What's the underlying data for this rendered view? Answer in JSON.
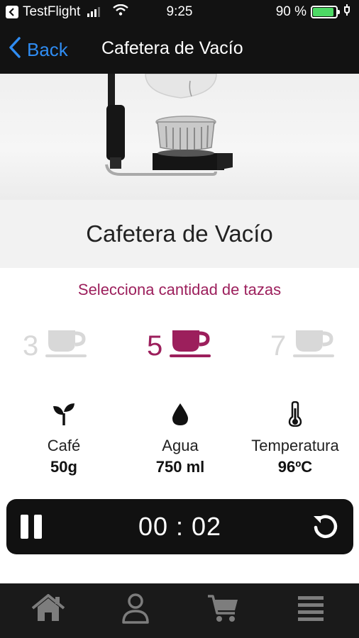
{
  "status_bar": {
    "carrier": "TestFlight",
    "time": "9:25",
    "battery_percent": "90 %",
    "battery_level": 0.9,
    "signal_bars": 3,
    "icons": [
      "back-to-app-icon",
      "signal-icon",
      "wifi-icon",
      "battery-icon",
      "charging-icon"
    ]
  },
  "nav": {
    "back_label": "Back",
    "title": "Cafetera de Vacío"
  },
  "product": {
    "title": "Cafetera de Vacío"
  },
  "selector": {
    "instruction": "Selecciona cantidad de tazas",
    "options": [
      {
        "count": "3",
        "selected": false
      },
      {
        "count": "5",
        "selected": true
      },
      {
        "count": "7",
        "selected": false
      }
    ]
  },
  "specs": {
    "coffee": {
      "label": "Café",
      "value": "50g",
      "icon": "sprout-icon"
    },
    "water": {
      "label": "Agua",
      "value": "750 ml",
      "icon": "water-drop-icon"
    },
    "temperature": {
      "label": "Temperatura",
      "value": "96ºC",
      "icon": "thermometer-icon"
    }
  },
  "timer": {
    "value": "00 : 02",
    "icons": [
      "pause-icon",
      "reset-icon"
    ]
  },
  "tabs": [
    {
      "name": "home",
      "icon": "home-icon"
    },
    {
      "name": "profile",
      "icon": "user-icon"
    },
    {
      "name": "cart",
      "icon": "cart-icon"
    },
    {
      "name": "menu",
      "icon": "menu-icon"
    }
  ],
  "colors": {
    "accent": "#9c1f5c",
    "link": "#2f8cf2",
    "inactive": "#d8d8d8",
    "bars": "#121212",
    "battery": "#4cd964"
  }
}
